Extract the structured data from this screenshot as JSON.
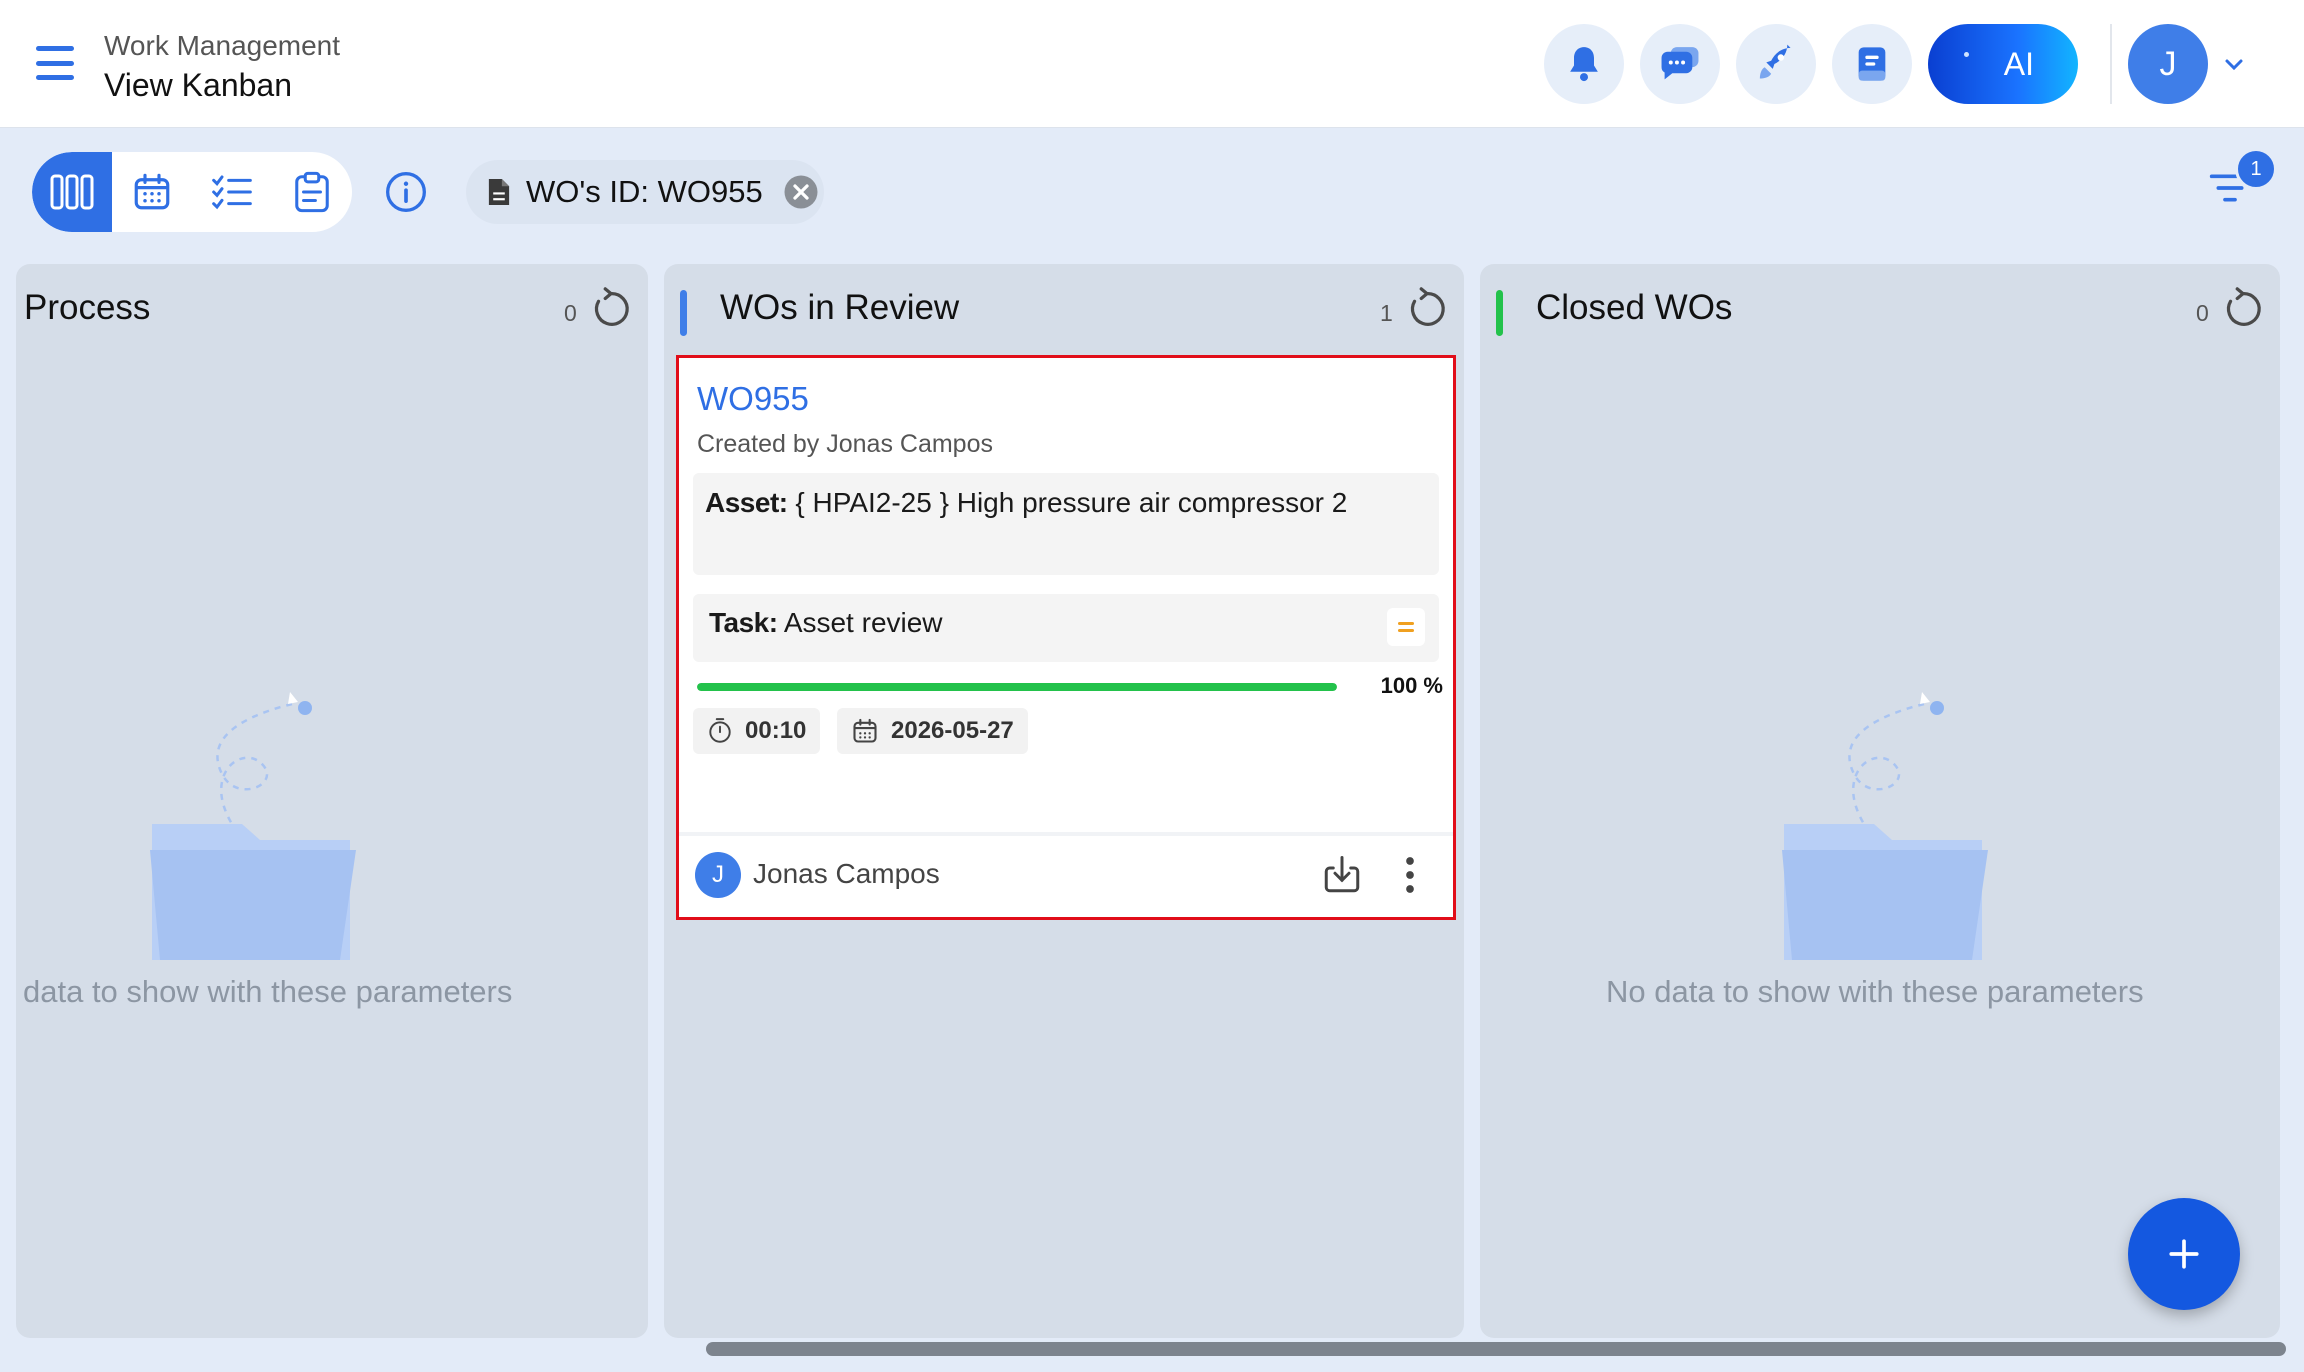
{
  "header": {
    "app_title": "Work Management",
    "page_title": "View Kanban",
    "ai_label": "AI",
    "user_initial": "J"
  },
  "toolbar": {
    "views": [
      "kanban-view",
      "calendar-view",
      "checklist-view",
      "clipboard-view"
    ],
    "active_view": "kanban-view",
    "filter_chip": "WO's ID: WO955",
    "filter_count": "1"
  },
  "columns": [
    {
      "title": "Process",
      "count": "0",
      "accent": "",
      "empty_text": "data to show with these parameters"
    },
    {
      "title": "WOs in Review",
      "count": "1",
      "accent": "#3f7ee8",
      "cards": [
        {
          "id": "WO955",
          "created_by": "Created by Jonas Campos",
          "asset_label": "Asset:",
          "asset_value": "{ HPAI2-25 } High pressure air compressor 2",
          "task_label": "Task:",
          "task_value": "Asset review",
          "priority": "=",
          "progress_value": 100,
          "progress_text": "100 %",
          "duration": "00:10",
          "date": "2026-05-27",
          "assignee_initial": "J",
          "assignee": "Jonas Campos"
        }
      ]
    },
    {
      "title": "Closed WOs",
      "count": "0",
      "accent": "#23c24b",
      "empty_text": "No data to show with these parameters"
    }
  ],
  "colors": {
    "primary": "#2f6fe4",
    "highlight_border": "#e10d19",
    "progress": "#23c24b",
    "priority": "#f0a020"
  }
}
